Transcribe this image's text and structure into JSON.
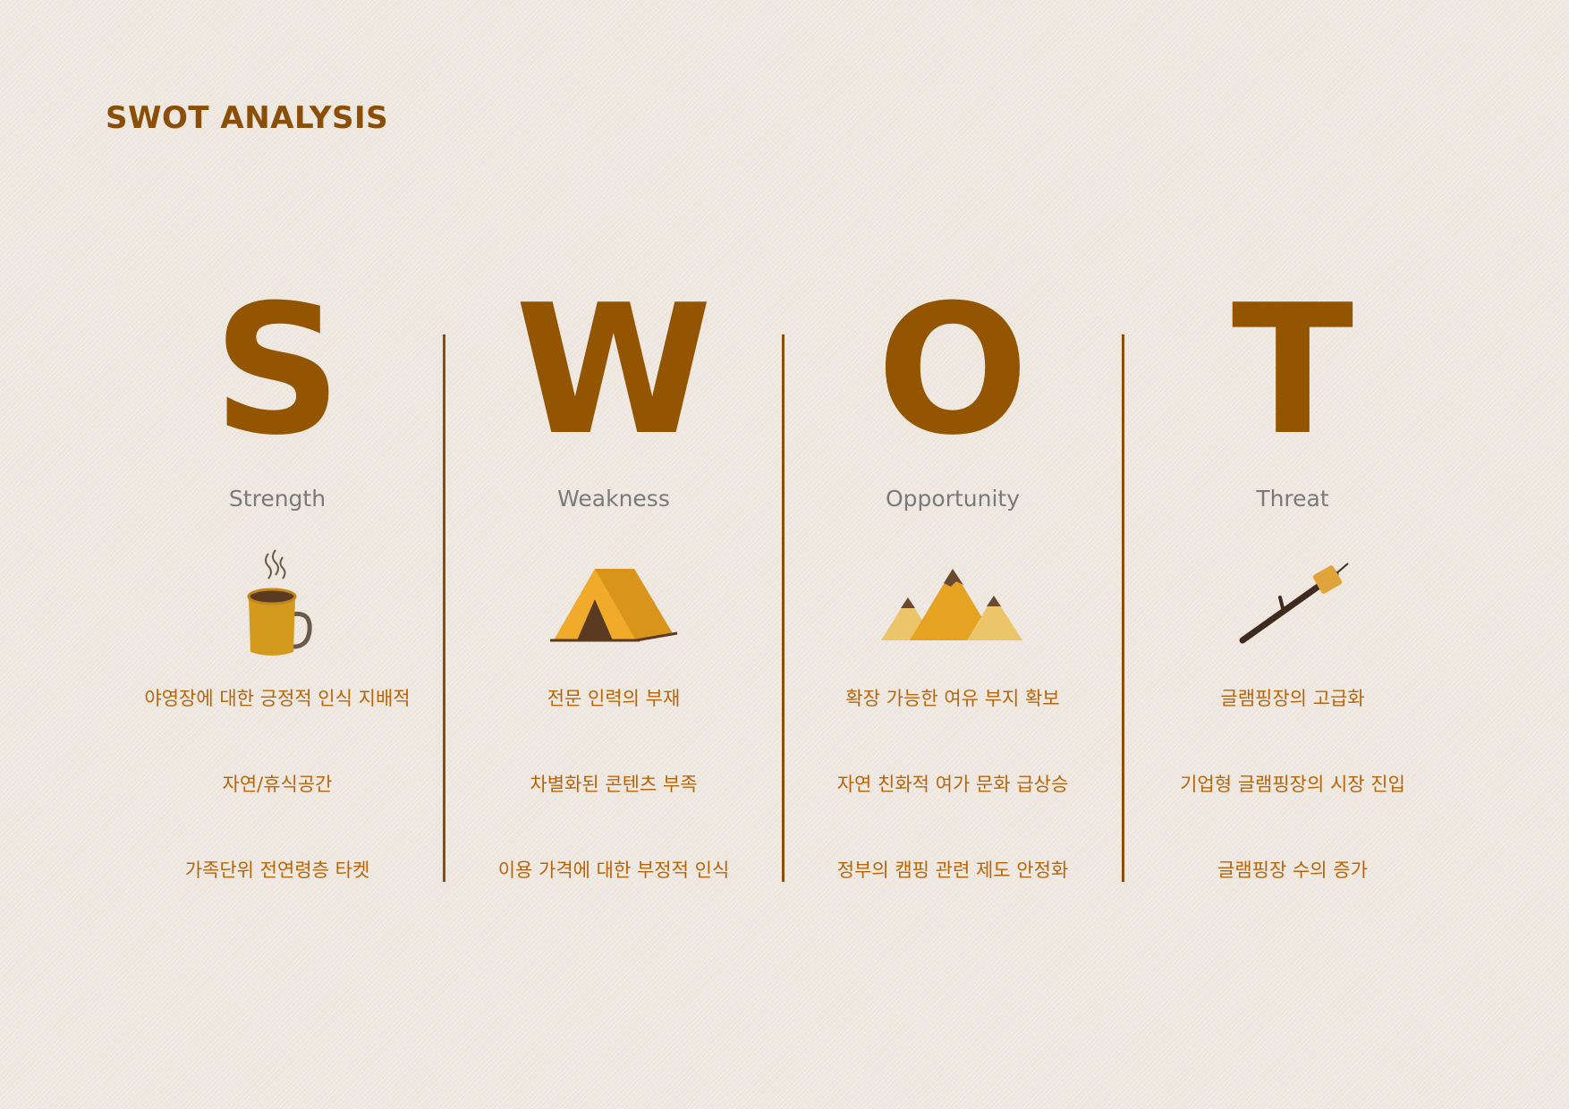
{
  "title": "SWOT ANALYSIS",
  "colors": {
    "accent": "#935500",
    "item_text": "#b8650a",
    "subtitle": "#7a7a7a",
    "background": "#efe8e0"
  },
  "columns": [
    {
      "letter": "S",
      "label": "Strength",
      "icon": "coffee-mug-icon",
      "items": [
        "야영장에 대한 긍정적 인식 지배적",
        "자연/휴식공간",
        "가족단위 전연령층 타켓"
      ]
    },
    {
      "letter": "W",
      "label": "Weakness",
      "icon": "tent-icon",
      "items": [
        "전문 인력의 부재",
        "차별화된 콘텐츠 부족",
        "이용 가격에 대한 부정적 인식"
      ]
    },
    {
      "letter": "O",
      "label": "Opportunity",
      "icon": "mountains-icon",
      "items": [
        "확장 가능한 여유 부지 확보",
        "자연 친화적 여가 문화 급상승",
        "정부의 캠핑 관련 제도 안정화"
      ]
    },
    {
      "letter": "T",
      "label": "Threat",
      "icon": "marshmallow-stick-icon",
      "items": [
        "글램핑장의 고급화",
        "기업형 글램핑장의 시장 진입",
        "글램핑장 수의 증가"
      ]
    }
  ]
}
